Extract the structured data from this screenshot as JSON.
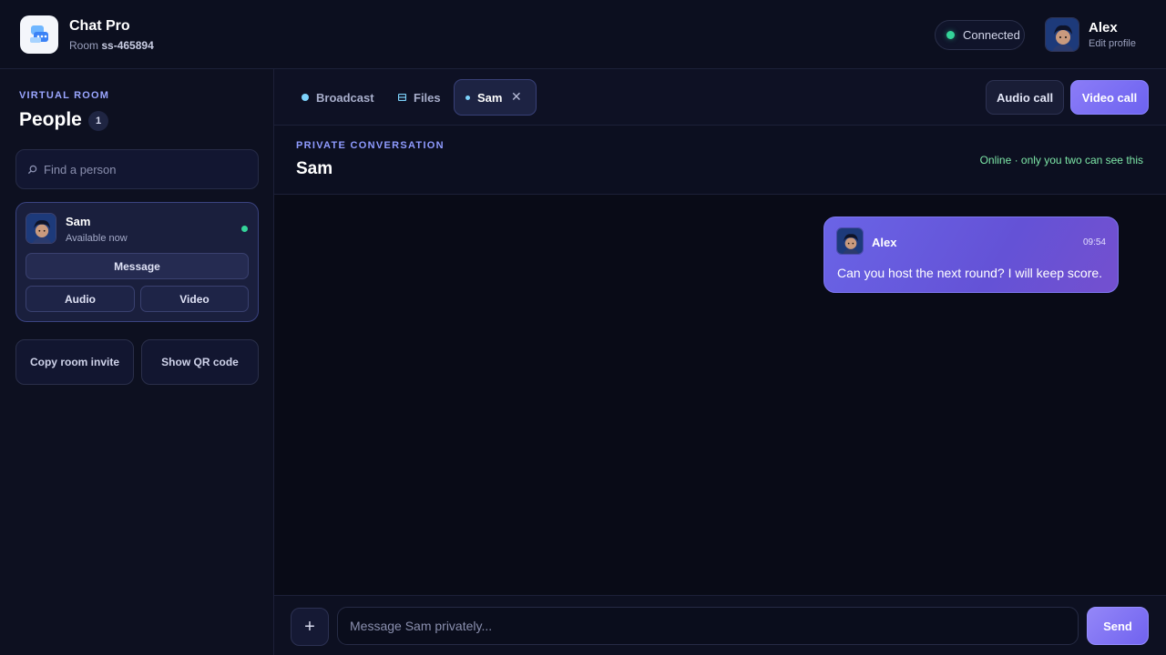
{
  "app": {
    "title": "Chat Pro",
    "room_prefix": "Room",
    "room_id": "ss-465894",
    "logo_icon": "chat-bubbles-icon"
  },
  "connection": {
    "label": "Connected",
    "color": "#34d399"
  },
  "current_user": {
    "name": "Alex",
    "edit_label": "Edit profile"
  },
  "sidebar": {
    "kicker": "VIRTUAL ROOM",
    "title": "People",
    "count": "1",
    "search_placeholder": "Find a person",
    "people": [
      {
        "name": "Sam",
        "status": "Available now",
        "online": true,
        "message_label": "Message",
        "audio_label": "Audio",
        "video_label": "Video"
      }
    ],
    "copy_invite_label": "Copy room invite",
    "qr_label": "Show QR code"
  },
  "tabs": [
    {
      "label": "Broadcast",
      "icon": "broadcast-dot-icon"
    },
    {
      "label": "Files",
      "icon": "files-icon"
    },
    {
      "label": "Sam",
      "icon": "presence-dot-icon",
      "active": true,
      "closable": true
    }
  ],
  "call_buttons": {
    "audio": "Audio call",
    "video": "Video call"
  },
  "conversation": {
    "kicker": "PRIVATE CONVERSATION",
    "title": "Sam",
    "note": "Online · only you two can see this"
  },
  "messages": [
    {
      "author": "Alex",
      "time": "09:54",
      "text": "Can you host the next round? I will keep score."
    }
  ],
  "composer": {
    "placeholder": "Message Sam privately...",
    "send_label": "Send",
    "add_symbol": "+"
  },
  "colors": {
    "accent": "#7c6ff5",
    "online": "#34d399",
    "kicker": "#9aa6ff"
  }
}
